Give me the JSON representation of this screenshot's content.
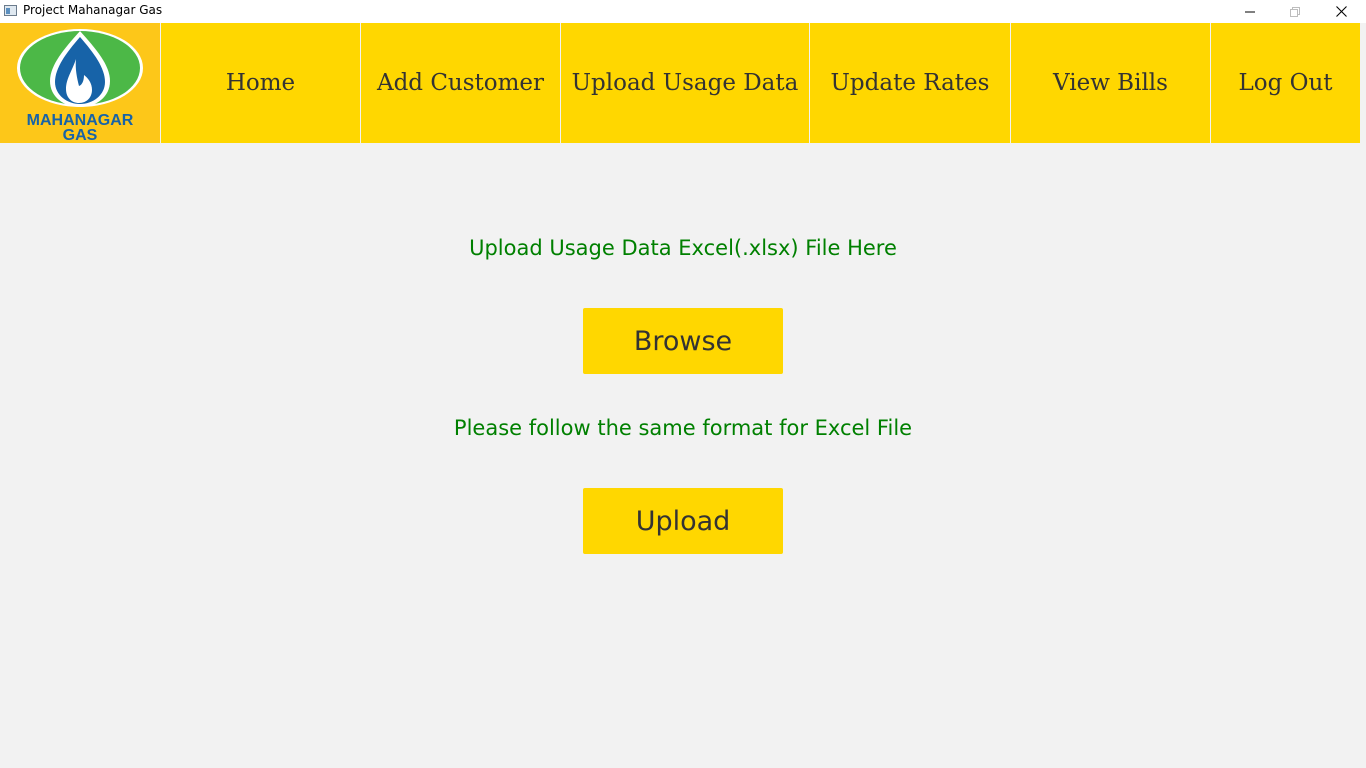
{
  "window": {
    "title": "Project Mahanagar Gas"
  },
  "logo": {
    "line1": "MAHANAGAR",
    "line2": "GAS"
  },
  "nav": {
    "home": "Home",
    "add_customer": "Add Customer",
    "upload_usage": "Upload Usage Data",
    "update_rates": "Update Rates",
    "view_bills": "View Bills",
    "log_out": "Log Out"
  },
  "main": {
    "heading": "Upload Usage Data Excel(.xlsx) File Here",
    "browse_label": "Browse",
    "note": "Please follow the same format for Excel File",
    "upload_label": "Upload"
  },
  "colors": {
    "nav_bg": "#ffd700",
    "logo_bg": "#fdc719",
    "text_green": "#008000",
    "page_bg": "#f2f2f2",
    "logo_blue": "#1763a8",
    "logo_green": "#4cb847"
  },
  "icons": {
    "app": "app-window-icon",
    "minimize": "minimize-icon",
    "maximize": "maximize-icon",
    "close": "close-icon",
    "logo": "gas-flame-logo-icon"
  }
}
